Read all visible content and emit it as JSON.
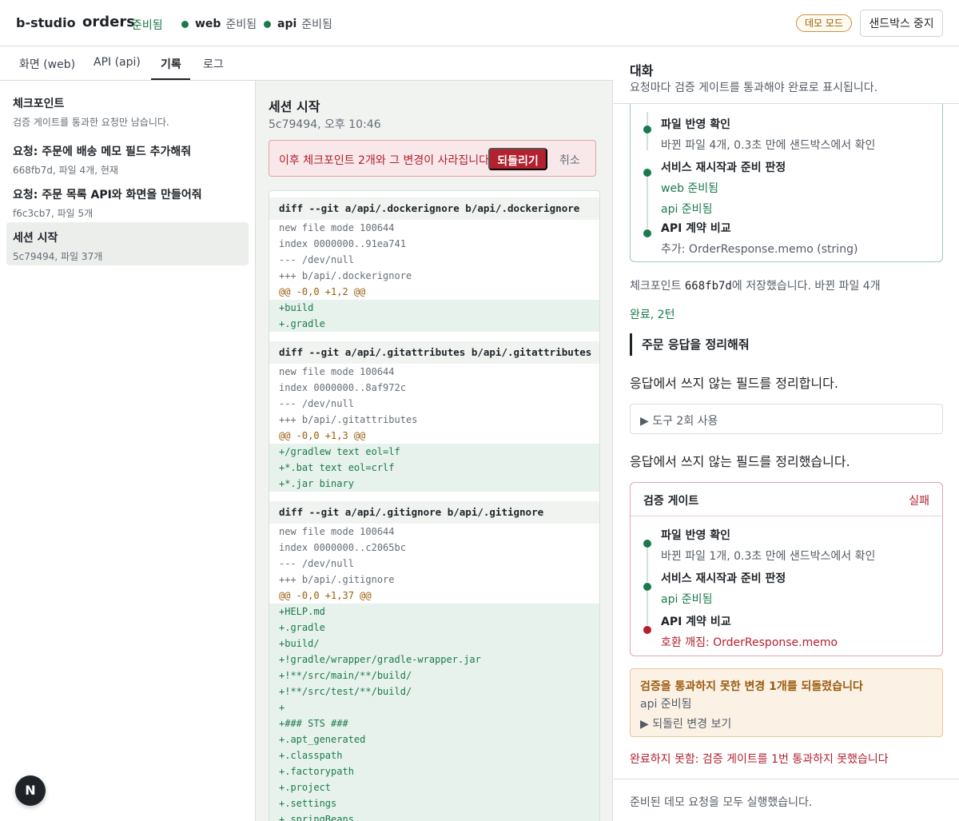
{
  "header": {
    "brand": "b-studio",
    "project": "orders",
    "project_status": "준비됨",
    "services": [
      {
        "name": "web",
        "status": "준비됨"
      },
      {
        "name": "api",
        "status": "준비됨"
      }
    ],
    "demo_badge": "데모 모드",
    "stop_button": "샌드박스 중지",
    "status_color": "#1a7a4c"
  },
  "tabs": [
    {
      "label": "화면 (web)",
      "active": false
    },
    {
      "label": "API (api)",
      "active": false
    },
    {
      "label": "기록",
      "active": true
    },
    {
      "label": "로그",
      "active": false
    }
  ],
  "checkpoints": {
    "title": "체크포인트",
    "subtitle": "검증 게이트를 통과한 요청만 남습니다.",
    "items": [
      {
        "title": "요청: 주문에 배송 메모 필드 추가해줘",
        "meta": "668fb7d, 파일 4개, 현재",
        "selected": false
      },
      {
        "title": "요청: 주문 목록 API와 화면을 만들어줘",
        "meta": "f6c3cb7, 파일 5개",
        "selected": false
      },
      {
        "title": "세션 시작",
        "meta": "5c79494, 파일 37개",
        "selected": true
      }
    ]
  },
  "detail": {
    "title": "세션 시작",
    "subtitle": "5c79494, 오후 10:46",
    "warning": "이후 체크포인트 2개와 그 변경이 사라집니다.",
    "revert_button": "되돌리기",
    "cancel_button": "취소",
    "diff": [
      {
        "kind": "head",
        "text": "diff --git a/api/.dockerignore b/api/.dockerignore"
      },
      {
        "kind": "meta",
        "text": "new file mode 100644"
      },
      {
        "kind": "meta",
        "text": "index 0000000..91ea741"
      },
      {
        "kind": "meta",
        "text": "--- /dev/null"
      },
      {
        "kind": "meta",
        "text": "+++ b/api/.dockerignore"
      },
      {
        "kind": "hunk",
        "text": "@@ -0,0 +1,2 @@"
      },
      {
        "kind": "add",
        "text": "+build"
      },
      {
        "kind": "add",
        "text": "+.gradle"
      },
      {
        "kind": "head",
        "text": "diff --git a/api/.gitattributes b/api/.gitattributes"
      },
      {
        "kind": "meta",
        "text": "new file mode 100644"
      },
      {
        "kind": "meta",
        "text": "index 0000000..8af972c"
      },
      {
        "kind": "meta",
        "text": "--- /dev/null"
      },
      {
        "kind": "meta",
        "text": "+++ b/api/.gitattributes"
      },
      {
        "kind": "hunk",
        "text": "@@ -0,0 +1,3 @@"
      },
      {
        "kind": "add",
        "text": "+/gradlew text eol=lf"
      },
      {
        "kind": "add",
        "text": "+*.bat text eol=crlf"
      },
      {
        "kind": "add",
        "text": "+*.jar binary"
      },
      {
        "kind": "head",
        "text": "diff --git a/api/.gitignore b/api/.gitignore"
      },
      {
        "kind": "meta",
        "text": "new file mode 100644"
      },
      {
        "kind": "meta",
        "text": "index 0000000..c2065bc"
      },
      {
        "kind": "meta",
        "text": "--- /dev/null"
      },
      {
        "kind": "meta",
        "text": "+++ b/api/.gitignore"
      },
      {
        "kind": "hunk",
        "text": "@@ -0,0 +1,37 @@"
      },
      {
        "kind": "add",
        "text": "+HELP.md"
      },
      {
        "kind": "add",
        "text": "+.gradle"
      },
      {
        "kind": "add",
        "text": "+build/"
      },
      {
        "kind": "add",
        "text": "+!gradle/wrapper/gradle-wrapper.jar"
      },
      {
        "kind": "add",
        "text": "+!**/src/main/**/build/"
      },
      {
        "kind": "add",
        "text": "+!**/src/test/**/build/"
      },
      {
        "kind": "add",
        "text": "+"
      },
      {
        "kind": "add",
        "text": "+### STS ###"
      },
      {
        "kind": "add",
        "text": "+.apt_generated"
      },
      {
        "kind": "add",
        "text": "+.classpath"
      },
      {
        "kind": "add",
        "text": "+.factorypath"
      },
      {
        "kind": "add",
        "text": "+.project"
      },
      {
        "kind": "add",
        "text": "+.settings"
      },
      {
        "kind": "add",
        "text": "+.springBeans"
      }
    ]
  },
  "chat": {
    "title": "대화",
    "subtitle": "요청마다 검증 게이트를 통과해야 완료로 표시됩니다.",
    "gate1_steps": [
      {
        "title": "파일 반영 확인",
        "details": [
          {
            "text": "바뀐 파일 4개, 0.3초 만에 샌드박스에서 확인",
            "tone": "muted"
          }
        ],
        "status": "ok"
      },
      {
        "title": "서비스 재시작과 준비 판정",
        "details": [
          {
            "text": "web 준비됨",
            "tone": "ok"
          },
          {
            "text": "api 준비됨",
            "tone": "ok"
          }
        ],
        "status": "ok"
      },
      {
        "title": "API 계약 비교",
        "details": [
          {
            "text": "추가: OrderResponse.memo (string)",
            "tone": "muted"
          }
        ],
        "status": "ok"
      }
    ],
    "checkpoint_note_prefix": "체크포인트 ",
    "checkpoint_note_hash": "668fb7d",
    "checkpoint_note_suffix": "에 저장했습니다. 바뀐 파일 4개",
    "done_label": "완료, 2턴",
    "user_message": "주문 응답을 정리해줘",
    "assistant_1": "응답에서 쓰지 않는 필드를 정리합니다.",
    "tool_summary": "▶ 도구 2회 사용",
    "assistant_2": "응답에서 쓰지 않는 필드를 정리했습니다.",
    "gate2": {
      "title": "검증 게이트",
      "result": "실패",
      "steps": [
        {
          "title": "파일 반영 확인",
          "details": [
            {
              "text": "바뀐 파일 1개, 0.3초 만에 샌드박스에서 확인",
              "tone": "muted"
            }
          ],
          "status": "ok"
        },
        {
          "title": "서비스 재시작과 준비 판정",
          "details": [
            {
              "text": "api 준비됨",
              "tone": "ok"
            }
          ],
          "status": "ok"
        },
        {
          "title": "API 계약 비교",
          "details": [
            {
              "text": "호환 깨짐: OrderResponse.memo",
              "tone": "err"
            }
          ],
          "status": "err"
        }
      ]
    },
    "rollback": {
      "title": "검증을 통과하지 못한 변경 1개를 되돌렸습니다",
      "detail": "api 준비됨",
      "summary": "▶ 되돌린 변경 보기"
    },
    "incomplete": "완료하지 못함: 검증 게이트를 1번 통과하지 못했습니다",
    "footer": "준비된 데모 요청을 모두 실행했습니다."
  },
  "fab_label": "N",
  "colors": {
    "ok": "#1a7a4c",
    "error": "#b3202e",
    "warning": "#9a5b0c"
  }
}
